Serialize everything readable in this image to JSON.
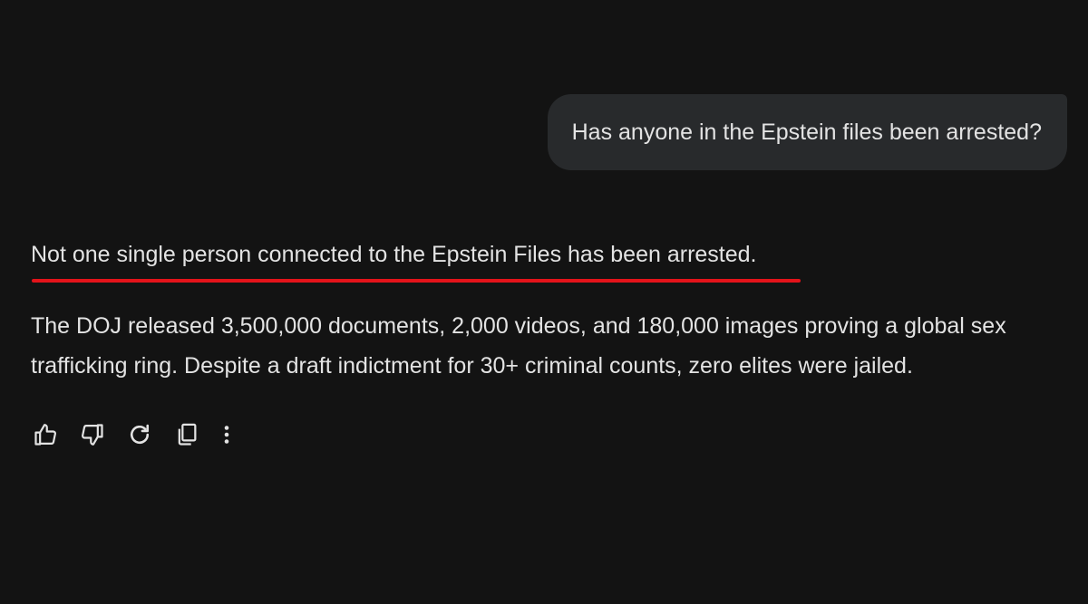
{
  "conversation": {
    "user_message": "Has anyone in the Epstein files been arrested?",
    "response": {
      "headline": "Not one single person connected to the Epstein Files has been arrested.",
      "body": "The DOJ released 3,500,000 documents, 2,000 videos, and 180,000 images proving a global sex trafficking ring. Despite a draft indictment for 30+ criminal counts, zero elites were jailed.",
      "underline_color": "#e3131a"
    },
    "actions": [
      {
        "icon": "thumbs-up-icon"
      },
      {
        "icon": "thumbs-down-icon"
      },
      {
        "icon": "regenerate-icon"
      },
      {
        "icon": "copy-icon"
      },
      {
        "icon": "more-vertical-icon"
      }
    ]
  },
  "colors": {
    "background": "#131313",
    "user_bubble": "#282a2c",
    "text": "#e3e3e3",
    "accent_underline": "#e3131a"
  }
}
